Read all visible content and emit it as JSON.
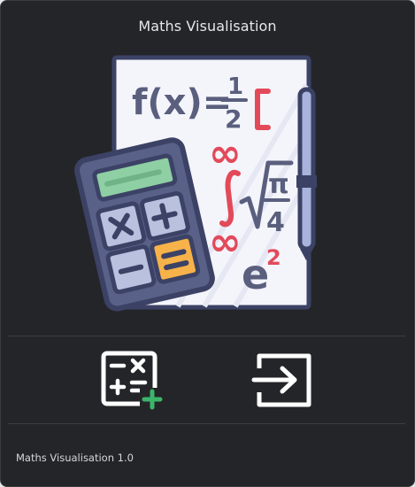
{
  "window": {
    "title": "Maths Visualisation"
  },
  "hero": {
    "icon": "maths-illustration-icon",
    "formula_text": "f(x)=½[",
    "infinity_symbol": "∞",
    "sqrt_numerator": "π",
    "sqrt_denominator": "4",
    "exponent_base": "e",
    "exponent_power": "2"
  },
  "actions": [
    {
      "icon": "new-calculation-icon"
    },
    {
      "icon": "exit-icon"
    }
  ],
  "footer": {
    "version_text": "Maths Visualisation 1.0"
  },
  "colors": {
    "background": "#242529",
    "paper": "#f4f5fb",
    "outline": "#3c4265",
    "accent_red": "#e24a5a",
    "calculator_body": "#5a6188",
    "screen_green": "#8fcfa4",
    "key_orange": "#f7b24a",
    "plus_green": "#3bb56a"
  }
}
